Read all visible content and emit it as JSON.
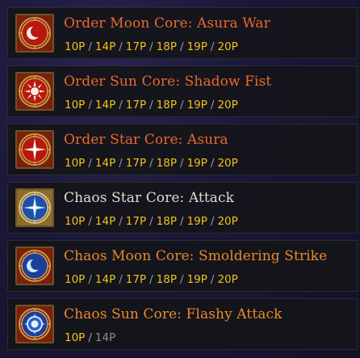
{
  "items": [
    {
      "name": "Order Moon Core: Asura War",
      "color": "#ea6a2c",
      "icon": "moon-icon",
      "levels": [
        {
          "label": "10P",
          "active": true
        },
        {
          "label": "14P",
          "active": true
        },
        {
          "label": "17P",
          "active": true
        },
        {
          "label": "18P",
          "active": true
        },
        {
          "label": "19P",
          "active": true
        },
        {
          "label": "20P",
          "active": true
        }
      ]
    },
    {
      "name": "Order Sun Core: Shadow Fist",
      "color": "#ea6a2c",
      "icon": "sun-icon",
      "levels": [
        {
          "label": "10P",
          "active": true
        },
        {
          "label": "14P",
          "active": true
        },
        {
          "label": "17P",
          "active": true
        },
        {
          "label": "18P",
          "active": true
        },
        {
          "label": "19P",
          "active": true
        },
        {
          "label": "20P",
          "active": true
        }
      ]
    },
    {
      "name": "Order Star Core: Asura",
      "color": "#ea6a2c",
      "icon": "star-icon",
      "levels": [
        {
          "label": "10P",
          "active": true
        },
        {
          "label": "14P",
          "active": true
        },
        {
          "label": "17P",
          "active": true
        },
        {
          "label": "18P",
          "active": true
        },
        {
          "label": "19P",
          "active": true
        },
        {
          "label": "20P",
          "active": true
        }
      ]
    },
    {
      "name": "Chaos Star Core: Attack",
      "color": "#e3dccd",
      "icon": "star-icon",
      "levels": [
        {
          "label": "10P",
          "active": true
        },
        {
          "label": "14P",
          "active": true
        },
        {
          "label": "17P",
          "active": true
        },
        {
          "label": "18P",
          "active": true
        },
        {
          "label": "19P",
          "active": true
        },
        {
          "label": "20P",
          "active": true
        }
      ]
    },
    {
      "name": "Chaos Moon Core: Smoldering Strike",
      "color": "#ea8a2a",
      "icon": "moon-icon",
      "levels": [
        {
          "label": "10P",
          "active": true
        },
        {
          "label": "14P",
          "active": true
        },
        {
          "label": "17P",
          "active": true
        },
        {
          "label": "18P",
          "active": true
        },
        {
          "label": "19P",
          "active": true
        },
        {
          "label": "20P",
          "active": true
        }
      ]
    },
    {
      "name": "Chaos Sun Core: Flashy Attack",
      "color": "#ea8a2a",
      "icon": "sun-icon",
      "levels": [
        {
          "label": "10P",
          "active": true
        },
        {
          "label": "14P",
          "active": false
        }
      ]
    }
  ]
}
